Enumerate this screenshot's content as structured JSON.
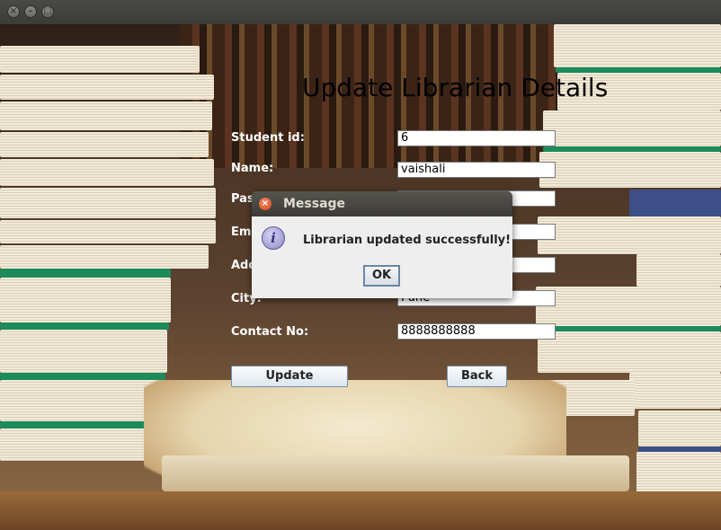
{
  "window": {
    "controls": [
      "close",
      "minimize",
      "maximize"
    ]
  },
  "form": {
    "heading": "Update Librarian Details",
    "fields": [
      {
        "label": "Student id:",
        "value": "6"
      },
      {
        "label": "Name:",
        "value": "vaishali"
      },
      {
        "label": "Pas",
        "value": ""
      },
      {
        "label": "Ema",
        "value": ""
      },
      {
        "label": "Add",
        "value": ""
      },
      {
        "label": "City:",
        "value": "Pune"
      },
      {
        "label": "Contact No:",
        "value": "8888888888"
      }
    ],
    "update_label": "Update",
    "back_label": "Back"
  },
  "dialog": {
    "title": "Message",
    "message": "Librarian updated successfully!",
    "ok_label": "OK",
    "icon": "info-icon"
  },
  "colors": {
    "dialog_title_bg": "#3c3b37",
    "close_accent": "#d4471b",
    "info_icon": "#8f89c8"
  }
}
